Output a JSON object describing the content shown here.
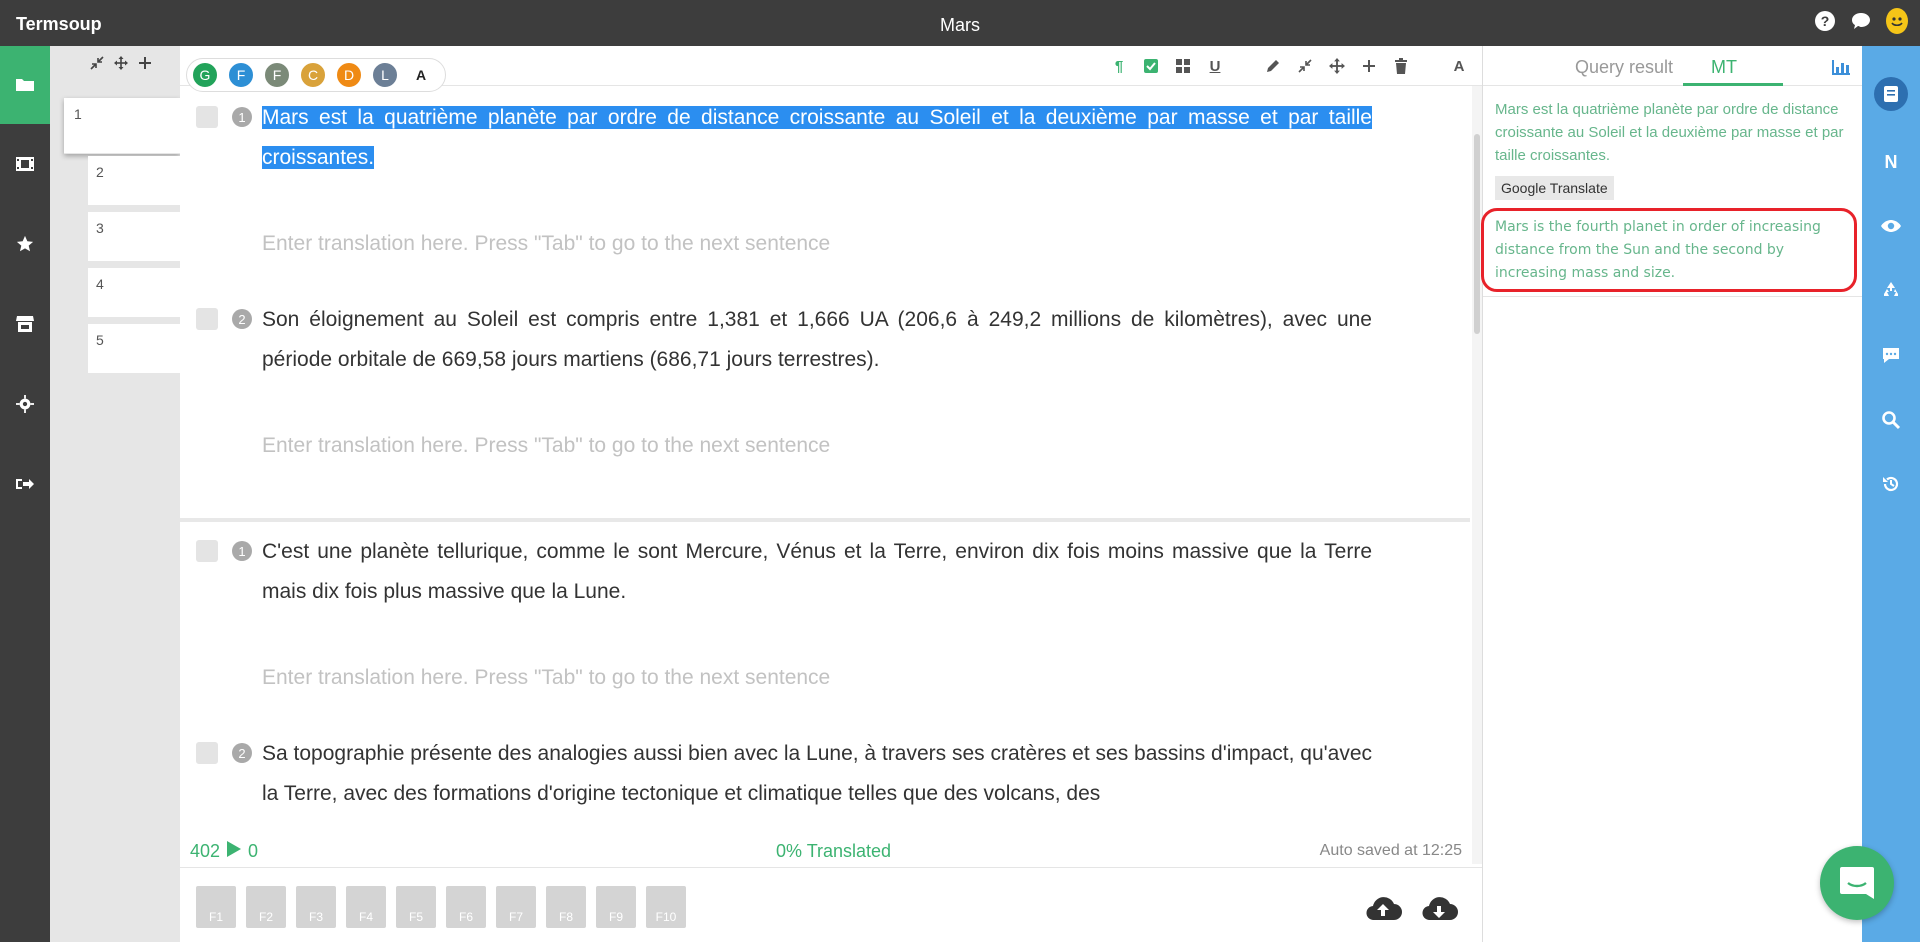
{
  "app": {
    "brand": "Termsoup",
    "document_title": "Mars"
  },
  "top_icons": [
    "help-icon",
    "chat-bubble-icon",
    "smiley-avatar-icon"
  ],
  "left_nav": [
    "folder-icon",
    "film-icon",
    "star-icon",
    "store-icon",
    "gear-icon",
    "logout-icon"
  ],
  "segment_list": {
    "items": [
      "1",
      "2",
      "3",
      "4",
      "5"
    ]
  },
  "collaborators": [
    {
      "letter": "G",
      "color": "#22a35a"
    },
    {
      "letter": "F",
      "color": "#2d8fd5"
    },
    {
      "letter": "F",
      "color": "#7b8a78"
    },
    {
      "letter": "C",
      "color": "#d9a23a"
    },
    {
      "letter": "D",
      "color": "#ef8a14"
    },
    {
      "letter": "L",
      "color": "#6c7f96"
    },
    {
      "letter": "A",
      "color": "#ffffff"
    }
  ],
  "editor": {
    "segments": [
      {
        "num": "1",
        "source_highlighted": "Mars est la quatrième planète par ordre de distance croissante au Soleil et la deuxième par masse et par taille croissantes.",
        "placeholder": "Enter translation here. Press \"Tab\" to go to the next sentence"
      },
      {
        "num": "2",
        "source": "Son éloignement au Soleil est compris entre 1,381 et 1,666 UA (206,6 à 249,2 millions de kilomètres), avec une période orbitale de 669,58 jours martiens (686,71 jours terrestres).",
        "placeholder": "Enter translation here. Press \"Tab\" to go to the next sentence"
      },
      {
        "num": "1",
        "source": "C'est une planète tellurique, comme le sont Mercure, Vénus et la Terre, environ dix fois moins massive que la Terre mais dix fois plus massive que la Lune.",
        "placeholder": "Enter translation here. Press \"Tab\" to go to the next sentence"
      },
      {
        "num": "2",
        "source": "Sa topographie présente des analogies aussi bien avec la Lune, à travers ses cratères et ses bassins d'impact, qu'avec la Terre, avec des formations d'origine tectonique et climatique telles que des volcans, des"
      }
    ]
  },
  "status": {
    "word_count": "402",
    "progress_count": "0",
    "translated": "0% Translated",
    "autosave": "Auto saved at 12:25"
  },
  "fkeys": [
    "F1",
    "F2",
    "F3",
    "F4",
    "F5",
    "F6",
    "F7",
    "F8",
    "F9",
    "F10"
  ],
  "right_panel": {
    "tabs": [
      "Query result",
      "MT"
    ],
    "active_tab": "MT",
    "mt_source": "Mars est la quatrième planète par ordre de distance croissante au Soleil et la deuxième par masse et par taille croissantes.",
    "engine_label": "Google Translate",
    "mt_output": "Mars is the fourth planet in order of increasing distance from the Sun and the second by increasing mass and size."
  },
  "right_rail": {
    "n_label": "N"
  },
  "accent": "#3cb371"
}
